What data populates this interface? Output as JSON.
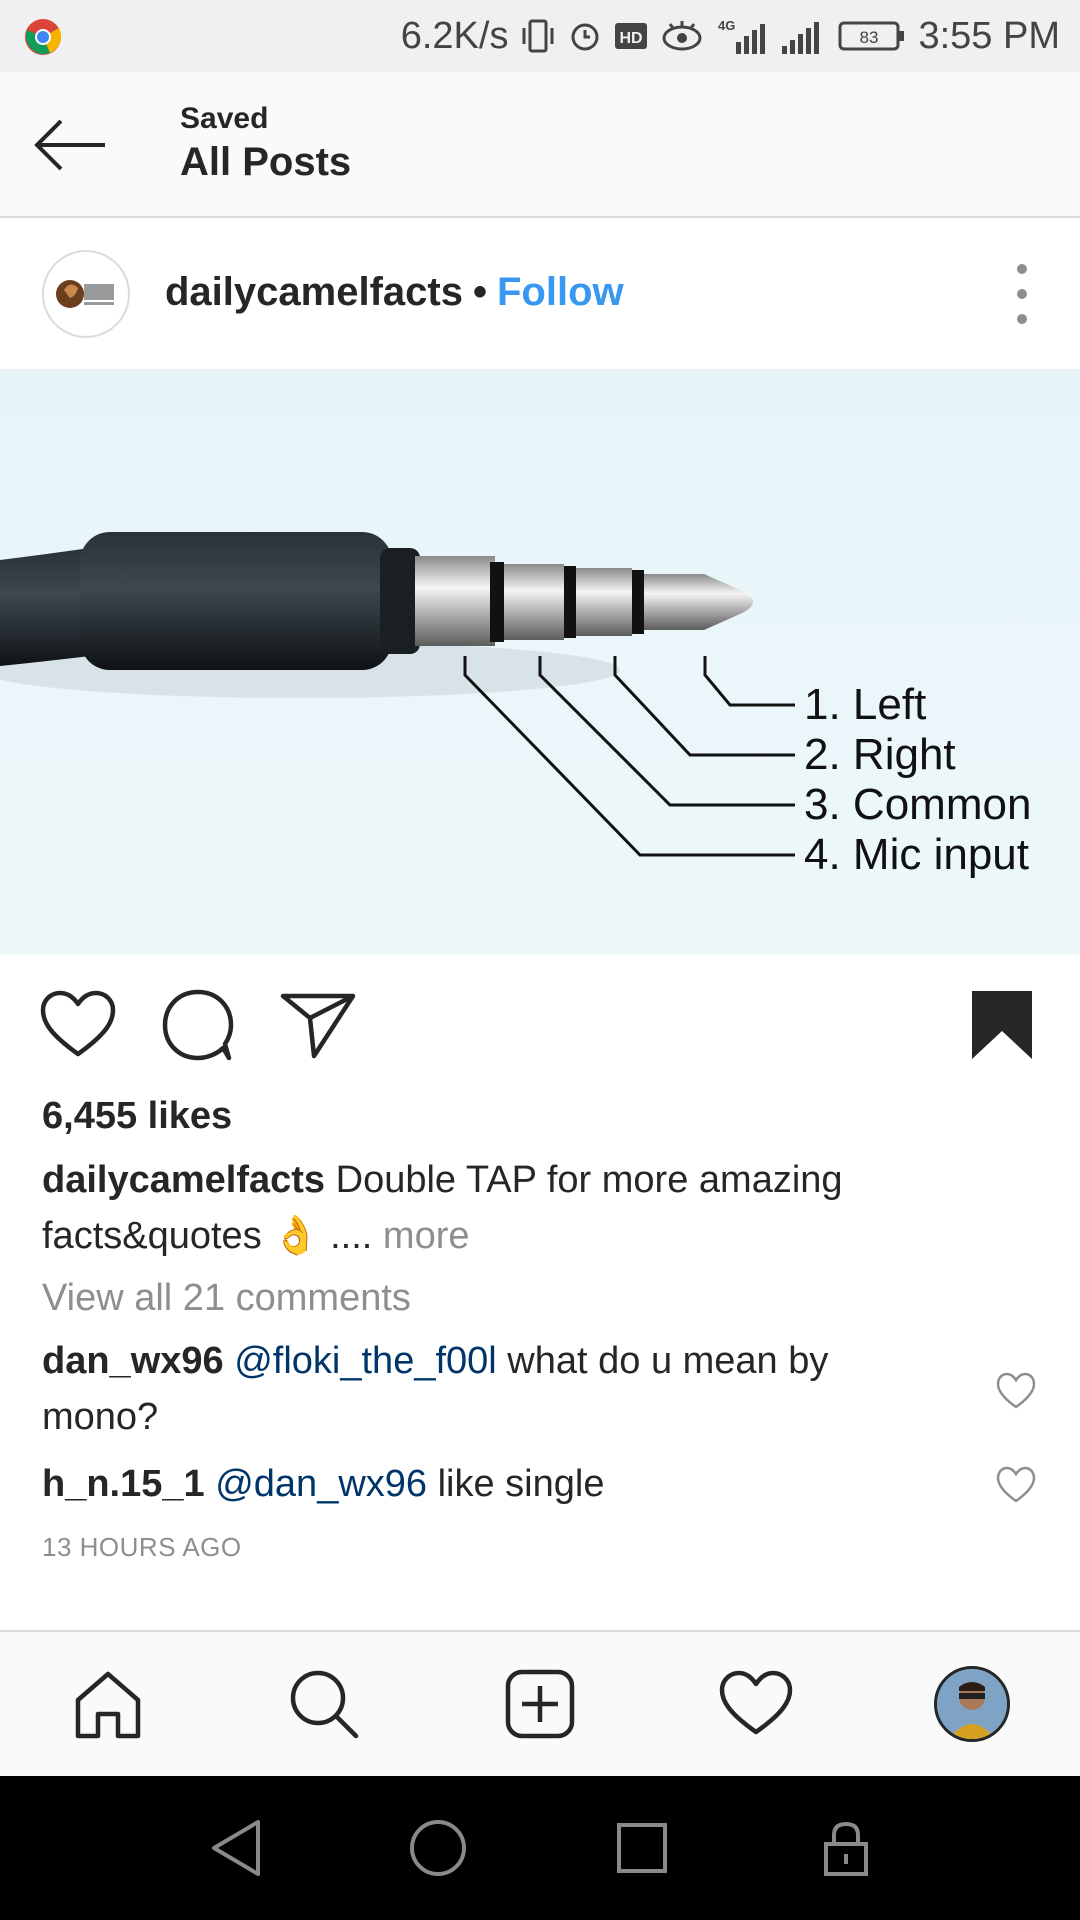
{
  "status_bar": {
    "speed": "6.2K/s",
    "network": "4G",
    "battery": "83",
    "time": "3:55 PM",
    "icons": [
      "chrome-icon",
      "vibrate-icon",
      "alarm-icon",
      "hd-icon",
      "eye-icon",
      "signal-icon",
      "battery-icon"
    ]
  },
  "header": {
    "subtitle": "Saved",
    "title": "All Posts"
  },
  "post": {
    "username": "dailycamelfacts",
    "separator": "•",
    "follow_label": "Follow",
    "image_labels": [
      "1. Left",
      "2. Right",
      "3. Common",
      "4. Mic input"
    ],
    "likes": "6,455 likes",
    "caption_user": "dailycamelfacts",
    "caption_text": "Double TAP for more amazing facts&quotes 👌 ....",
    "caption_more": "more",
    "view_all": "View all 21 comments",
    "comments": [
      {
        "user": "dan_wx96",
        "mention": "@floki_the_f00l",
        "text": "what do u mean by mono?"
      },
      {
        "user": "h_n.15_1",
        "mention": "@dan_wx96",
        "text": "like single"
      }
    ],
    "timestamp": "13 HOURS AGO",
    "saved": true
  },
  "bottom_nav": {
    "items": [
      "home-icon",
      "search-icon",
      "add-post-icon",
      "activity-heart-icon",
      "profile-avatar"
    ]
  },
  "system_nav": {
    "items": [
      "back-triangle-icon",
      "home-circle-icon",
      "recents-square-icon",
      "lock-icon"
    ]
  },
  "colors": {
    "follow": "#3897f0",
    "mention": "#003569",
    "muted": "#8e8e8e",
    "text": "#262626"
  }
}
